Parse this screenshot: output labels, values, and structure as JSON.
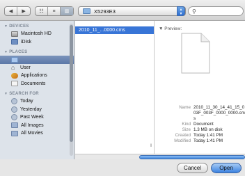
{
  "toolbar": {
    "nav": {
      "back": "◀",
      "forward": "▶"
    },
    "view_modes": [
      "☷",
      "≡",
      "▥"
    ],
    "location": "X5293E3",
    "search_placeholder": ""
  },
  "sidebar": {
    "devices_header": "DEVICES",
    "devices": [
      {
        "label": "Macintosh HD",
        "icon": "hard-drive-icon"
      },
      {
        "label": "iDisk",
        "icon": "idisk-icon"
      }
    ],
    "places_header": "PLACES",
    "places": [
      {
        "label": "",
        "icon": "folder-icon",
        "selected": true
      },
      {
        "label": "User",
        "icon": "home-icon"
      },
      {
        "label": "Applications",
        "icon": "applications-icon"
      },
      {
        "label": "Documents",
        "icon": "documents-icon"
      }
    ],
    "search_header": "SEARCH FOR",
    "searches": [
      {
        "label": "Today",
        "icon": "clock-icon"
      },
      {
        "label": "Yesterday",
        "icon": "clock-icon"
      },
      {
        "label": "Past Week",
        "icon": "clock-icon"
      },
      {
        "label": "All Images",
        "icon": "smart-folder-icon"
      },
      {
        "label": "All Movies",
        "icon": "smart-folder-icon"
      }
    ]
  },
  "files": [
    {
      "name": "2010_11_...0000.cms",
      "selected": true
    }
  ],
  "preview": {
    "label": "Preview:",
    "fields": [
      {
        "key": "Name",
        "value": "2010_11_30_14_41_15_003F_003F_0000_0000.cms"
      },
      {
        "key": "Kind",
        "value": "Document"
      },
      {
        "key": "Size",
        "value": "1.3 MB on disk"
      },
      {
        "key": "Created",
        "value": "Today 1:41 PM"
      },
      {
        "key": "Modified",
        "value": "Today 1:41 PM"
      }
    ]
  },
  "buttons": {
    "cancel": "Cancel",
    "open": "Open"
  },
  "colors": {
    "selection": "#3875d7",
    "default_button": "#3b82e0",
    "sidebar_bg": "#dde3ea"
  }
}
